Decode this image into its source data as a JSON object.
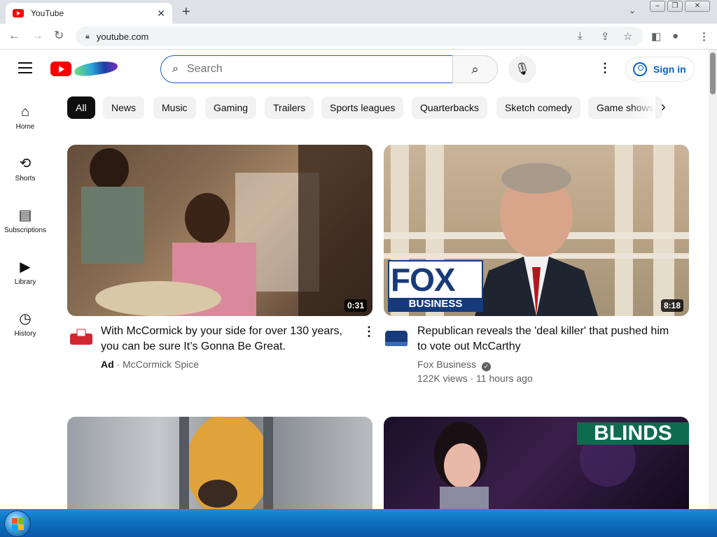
{
  "browser": {
    "tab_title": "YouTube",
    "url": "youtube.com"
  },
  "youtube": {
    "search_placeholder": "Search",
    "signin_label": "Sign in",
    "sidebar": [
      {
        "label": "Home",
        "icon": "home-icon"
      },
      {
        "label": "Shorts",
        "icon": "shorts-icon"
      },
      {
        "label": "Subscriptions",
        "icon": "subscriptions-icon"
      },
      {
        "label": "Library",
        "icon": "library-icon"
      },
      {
        "label": "History",
        "icon": "history-icon"
      }
    ],
    "chips": [
      "All",
      "News",
      "Music",
      "Gaming",
      "Trailers",
      "Sports leagues",
      "Quarterbacks",
      "Sketch comedy",
      "Game shows"
    ],
    "videos": [
      {
        "title": "With McCormick by your side for over 130 years, you can be sure It’s Gonna Be Great.",
        "duration": "0:31",
        "ad_label": "Ad",
        "channel": "McCormick Spice"
      },
      {
        "title": "Republican reveals the 'deal killer' that pushed him to vote out McCarthy",
        "duration": "8:18",
        "channel": "Fox Business",
        "views": "122K views",
        "age": "11 hours ago",
        "thumb_logo_top": "FOX",
        "thumb_logo_bottom": "BUSINESS"
      },
      {
        "title": "",
        "duration": ""
      },
      {
        "title": "",
        "thumb_text": "BLINDS"
      }
    ]
  },
  "colors": {
    "yt_red": "#ff0000",
    "link_blue": "#065fd4",
    "chip_active": "#0f0f0f"
  }
}
